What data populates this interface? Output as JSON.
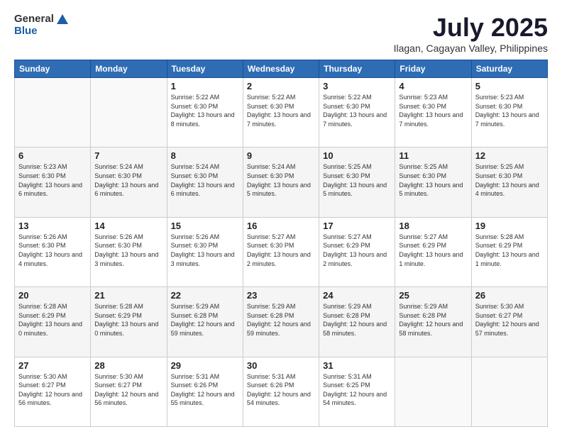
{
  "header": {
    "logo_general": "General",
    "logo_blue": "Blue",
    "title": "July 2025",
    "location": "Ilagan, Cagayan Valley, Philippines"
  },
  "weekdays": [
    "Sunday",
    "Monday",
    "Tuesday",
    "Wednesday",
    "Thursday",
    "Friday",
    "Saturday"
  ],
  "weeks": [
    [
      {
        "day": "",
        "sunrise": "",
        "sunset": "",
        "daylight": ""
      },
      {
        "day": "",
        "sunrise": "",
        "sunset": "",
        "daylight": ""
      },
      {
        "day": "1",
        "sunrise": "Sunrise: 5:22 AM",
        "sunset": "Sunset: 6:30 PM",
        "daylight": "Daylight: 13 hours and 8 minutes."
      },
      {
        "day": "2",
        "sunrise": "Sunrise: 5:22 AM",
        "sunset": "Sunset: 6:30 PM",
        "daylight": "Daylight: 13 hours and 7 minutes."
      },
      {
        "day": "3",
        "sunrise": "Sunrise: 5:22 AM",
        "sunset": "Sunset: 6:30 PM",
        "daylight": "Daylight: 13 hours and 7 minutes."
      },
      {
        "day": "4",
        "sunrise": "Sunrise: 5:23 AM",
        "sunset": "Sunset: 6:30 PM",
        "daylight": "Daylight: 13 hours and 7 minutes."
      },
      {
        "day": "5",
        "sunrise": "Sunrise: 5:23 AM",
        "sunset": "Sunset: 6:30 PM",
        "daylight": "Daylight: 13 hours and 7 minutes."
      }
    ],
    [
      {
        "day": "6",
        "sunrise": "Sunrise: 5:23 AM",
        "sunset": "Sunset: 6:30 PM",
        "daylight": "Daylight: 13 hours and 6 minutes."
      },
      {
        "day": "7",
        "sunrise": "Sunrise: 5:24 AM",
        "sunset": "Sunset: 6:30 PM",
        "daylight": "Daylight: 13 hours and 6 minutes."
      },
      {
        "day": "8",
        "sunrise": "Sunrise: 5:24 AM",
        "sunset": "Sunset: 6:30 PM",
        "daylight": "Daylight: 13 hours and 6 minutes."
      },
      {
        "day": "9",
        "sunrise": "Sunrise: 5:24 AM",
        "sunset": "Sunset: 6:30 PM",
        "daylight": "Daylight: 13 hours and 5 minutes."
      },
      {
        "day": "10",
        "sunrise": "Sunrise: 5:25 AM",
        "sunset": "Sunset: 6:30 PM",
        "daylight": "Daylight: 13 hours and 5 minutes."
      },
      {
        "day": "11",
        "sunrise": "Sunrise: 5:25 AM",
        "sunset": "Sunset: 6:30 PM",
        "daylight": "Daylight: 13 hours and 5 minutes."
      },
      {
        "day": "12",
        "sunrise": "Sunrise: 5:25 AM",
        "sunset": "Sunset: 6:30 PM",
        "daylight": "Daylight: 13 hours and 4 minutes."
      }
    ],
    [
      {
        "day": "13",
        "sunrise": "Sunrise: 5:26 AM",
        "sunset": "Sunset: 6:30 PM",
        "daylight": "Daylight: 13 hours and 4 minutes."
      },
      {
        "day": "14",
        "sunrise": "Sunrise: 5:26 AM",
        "sunset": "Sunset: 6:30 PM",
        "daylight": "Daylight: 13 hours and 3 minutes."
      },
      {
        "day": "15",
        "sunrise": "Sunrise: 5:26 AM",
        "sunset": "Sunset: 6:30 PM",
        "daylight": "Daylight: 13 hours and 3 minutes."
      },
      {
        "day": "16",
        "sunrise": "Sunrise: 5:27 AM",
        "sunset": "Sunset: 6:30 PM",
        "daylight": "Daylight: 13 hours and 2 minutes."
      },
      {
        "day": "17",
        "sunrise": "Sunrise: 5:27 AM",
        "sunset": "Sunset: 6:29 PM",
        "daylight": "Daylight: 13 hours and 2 minutes."
      },
      {
        "day": "18",
        "sunrise": "Sunrise: 5:27 AM",
        "sunset": "Sunset: 6:29 PM",
        "daylight": "Daylight: 13 hours and 1 minute."
      },
      {
        "day": "19",
        "sunrise": "Sunrise: 5:28 AM",
        "sunset": "Sunset: 6:29 PM",
        "daylight": "Daylight: 13 hours and 1 minute."
      }
    ],
    [
      {
        "day": "20",
        "sunrise": "Sunrise: 5:28 AM",
        "sunset": "Sunset: 6:29 PM",
        "daylight": "Daylight: 13 hours and 0 minutes."
      },
      {
        "day": "21",
        "sunrise": "Sunrise: 5:28 AM",
        "sunset": "Sunset: 6:29 PM",
        "daylight": "Daylight: 13 hours and 0 minutes."
      },
      {
        "day": "22",
        "sunrise": "Sunrise: 5:29 AM",
        "sunset": "Sunset: 6:28 PM",
        "daylight": "Daylight: 12 hours and 59 minutes."
      },
      {
        "day": "23",
        "sunrise": "Sunrise: 5:29 AM",
        "sunset": "Sunset: 6:28 PM",
        "daylight": "Daylight: 12 hours and 59 minutes."
      },
      {
        "day": "24",
        "sunrise": "Sunrise: 5:29 AM",
        "sunset": "Sunset: 6:28 PM",
        "daylight": "Daylight: 12 hours and 58 minutes."
      },
      {
        "day": "25",
        "sunrise": "Sunrise: 5:29 AM",
        "sunset": "Sunset: 6:28 PM",
        "daylight": "Daylight: 12 hours and 58 minutes."
      },
      {
        "day": "26",
        "sunrise": "Sunrise: 5:30 AM",
        "sunset": "Sunset: 6:27 PM",
        "daylight": "Daylight: 12 hours and 57 minutes."
      }
    ],
    [
      {
        "day": "27",
        "sunrise": "Sunrise: 5:30 AM",
        "sunset": "Sunset: 6:27 PM",
        "daylight": "Daylight: 12 hours and 56 minutes."
      },
      {
        "day": "28",
        "sunrise": "Sunrise: 5:30 AM",
        "sunset": "Sunset: 6:27 PM",
        "daylight": "Daylight: 12 hours and 56 minutes."
      },
      {
        "day": "29",
        "sunrise": "Sunrise: 5:31 AM",
        "sunset": "Sunset: 6:26 PM",
        "daylight": "Daylight: 12 hours and 55 minutes."
      },
      {
        "day": "30",
        "sunrise": "Sunrise: 5:31 AM",
        "sunset": "Sunset: 6:26 PM",
        "daylight": "Daylight: 12 hours and 54 minutes."
      },
      {
        "day": "31",
        "sunrise": "Sunrise: 5:31 AM",
        "sunset": "Sunset: 6:25 PM",
        "daylight": "Daylight: 12 hours and 54 minutes."
      },
      {
        "day": "",
        "sunrise": "",
        "sunset": "",
        "daylight": ""
      },
      {
        "day": "",
        "sunrise": "",
        "sunset": "",
        "daylight": ""
      }
    ]
  ]
}
